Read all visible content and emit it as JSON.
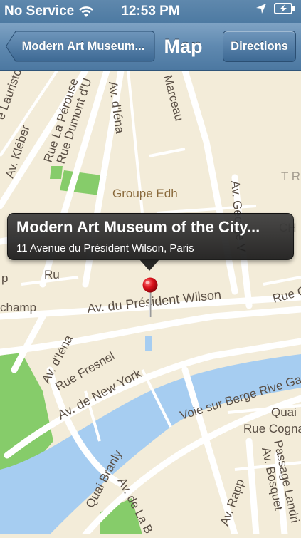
{
  "status_bar": {
    "carrier": "No Service",
    "time": "12:53 PM",
    "wifi_icon": "wifi-icon",
    "location_icon": "location-arrow-icon",
    "battery_icon": "battery-charging-icon"
  },
  "nav_bar": {
    "back_label": "Modern Art Museum...",
    "title": "Map",
    "directions_label": "Directions"
  },
  "callout": {
    "title": "Modern Art Museum of the City...",
    "subtitle": "11 Avenue du Président Wilson, Paris"
  },
  "map_labels": {
    "av_kleber": "Av. Kléber",
    "rue_la_perouse": "Rue La Pérouse",
    "rue_dumont": "Rue Dumont d'U",
    "av_iena_top": "Av. d'Iéna",
    "marceau": "Marceau",
    "lauristo": "e Lauristo",
    "groupe_edh": "Groupe Edh",
    "av_george_v": "Av. George V",
    "champ": "champ",
    "av_president_wilson": "Av. du Président Wilson",
    "rue_cour": "Rue Cour",
    "av_iena_bottom": "Av. d'Iéna",
    "rue_fresnel": "Rue Fresnel",
    "av_new_york": "Av. de New York",
    "voie_berge": "Voie sur Berge Rive Ga",
    "quai": "Quai",
    "rue_cognac": "Rue Cogna",
    "quai_branly": "Quai Branly",
    "av_rapp": "Av. Rapp",
    "av_la_b": "Av. de La B",
    "passage_landrieu": "Passage Landri",
    "av_bosquet": "Av. Bosquet",
    "tr": "T R",
    "ru": "Ru",
    "p": "p",
    "ch": "CH"
  },
  "colors": {
    "land": "#f3ecd9",
    "water": "#a6cdf1",
    "park": "#86cc6a",
    "road": "#ffffff",
    "nav_blue": "#5f89b0",
    "pin_red": "#d9111b"
  },
  "pin_icon": "red-map-pin-icon"
}
